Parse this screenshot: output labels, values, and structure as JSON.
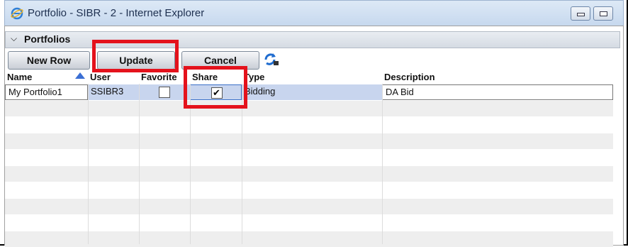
{
  "window": {
    "title": "Portfolio - SIBR - 2 - Internet Explorer"
  },
  "section": {
    "title": "Portfolios",
    "toggle_icon": "chevron-down-icon"
  },
  "toolbar": {
    "new_row_label": "New Row",
    "update_label": "Update",
    "cancel_label": "Cancel",
    "refresh_icon": "refresh-icon"
  },
  "columns": {
    "name": "Name",
    "user": "User",
    "favorite": "Favorite",
    "share": "Share",
    "type": "Type",
    "description": "Description"
  },
  "rows": [
    {
      "name": "My Portfolio1",
      "user": "SSIBR3",
      "favorite": false,
      "share": true,
      "type": "Bidding",
      "description": "DA Bid"
    }
  ],
  "colors": {
    "highlight": "#e4121c",
    "selected_row": "#c8d5ee"
  }
}
